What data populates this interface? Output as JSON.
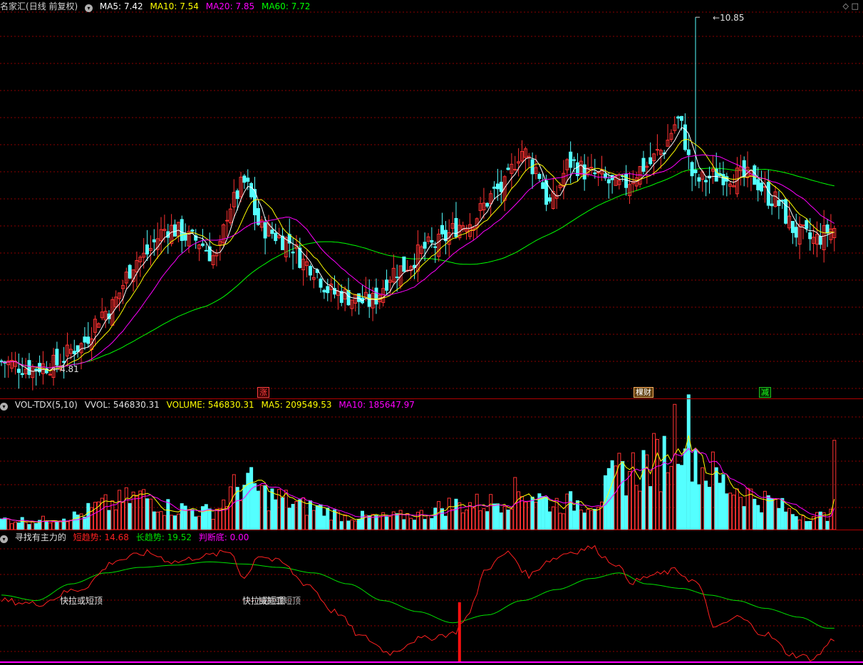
{
  "header": {
    "stock_name": "名家汇",
    "period": "(日线 前复权)",
    "ma5_label": "MA5:",
    "ma5_value": "7.42",
    "ma10_label": "MA10:",
    "ma10_value": "7.54",
    "ma20_label": "MA20:",
    "ma20_value": "7.85",
    "ma60_label": "MA60:",
    "ma60_value": "7.72"
  },
  "volume_header": {
    "indicator": "VOL-TDX(5,10)",
    "vvol_label": "VVOL:",
    "vvol_value": "546830.31",
    "volume_label": "VOLUME:",
    "volume_value": "546830.31",
    "ma5_label": "MA5:",
    "ma5_value": "209549.53",
    "ma10_label": "MA10:",
    "ma10_value": "185647.97"
  },
  "indicator_header": {
    "name": "寻找有主力的",
    "short_label": "短趋势:",
    "short_value": "14.68",
    "long_label": "长趋势:",
    "long_value": "19.52",
    "bottom_label": "判断底:",
    "bottom_value": "0.00"
  },
  "annotations": {
    "high_label": "10.85",
    "low_label": "4.81",
    "tag1": "涨",
    "tag2": "棵财",
    "tag3": "减",
    "signal1": "快拉或短顶",
    "signal2": "快拉或短顶",
    "signal2_overlap": "快拉或短顶"
  },
  "colors": {
    "up": "#ff3232",
    "down": "#54ffff",
    "ma5": "#ffffff",
    "ma10": "#ffff00",
    "ma20": "#ff00ff",
    "ma60": "#00ff00",
    "grid": "#8b0000",
    "short_trend": "#ff2020",
    "long_trend": "#00e000",
    "bottom": "#ff00ff"
  },
  "chart_data": [
    {
      "type": "candlestick",
      "title": "名家汇 (日线 前复权)",
      "ohlc_anchors": [
        [
          0,
          5.05
        ],
        [
          8,
          4.95
        ],
        [
          15,
          5.0
        ],
        [
          22,
          5.3
        ],
        [
          30,
          5.9
        ],
        [
          40,
          6.8
        ],
        [
          48,
          7.3
        ],
        [
          56,
          7.1
        ],
        [
          62,
          6.8
        ],
        [
          66,
          7.7
        ],
        [
          70,
          8.05
        ],
        [
          75,
          7.3
        ],
        [
          82,
          7.1
        ],
        [
          88,
          6.7
        ],
        [
          96,
          6.2
        ],
        [
          106,
          6.05
        ],
        [
          114,
          6.6
        ],
        [
          124,
          7.0
        ],
        [
          134,
          7.4
        ],
        [
          144,
          7.95
        ],
        [
          150,
          8.6
        ],
        [
          154,
          8.3
        ],
        [
          158,
          7.7
        ],
        [
          164,
          8.4
        ],
        [
          170,
          8.2
        ],
        [
          178,
          8.0
        ],
        [
          186,
          8.35
        ],
        [
          190,
          8.6
        ],
        [
          195,
          9.1
        ],
        [
          200,
          8.1
        ],
        [
          208,
          8.2
        ],
        [
          216,
          8.15
        ],
        [
          222,
          7.8
        ],
        [
          230,
          7.2
        ],
        [
          234,
          7.1
        ],
        [
          240,
          7.3
        ]
      ],
      "price_high": 10.85,
      "price_low": 4.81,
      "ma_current": {
        "MA5": 7.42,
        "MA10": 7.54,
        "MA20": 7.85,
        "MA60": 7.72
      }
    },
    {
      "type": "bar",
      "title": "VOL-TDX(5,10)",
      "series": [
        {
          "name": "VOLUME",
          "last": 546830.31
        },
        {
          "name": "MA5",
          "last": 209549.53
        },
        {
          "name": "MA10",
          "last": 185647.97
        }
      ],
      "volume_anchors": [
        [
          0,
          60000
        ],
        [
          10,
          55000
        ],
        [
          20,
          80000
        ],
        [
          30,
          150000
        ],
        [
          40,
          200000
        ],
        [
          50,
          130000
        ],
        [
          60,
          110000
        ],
        [
          70,
          280000
        ],
        [
          78,
          200000
        ],
        [
          88,
          140000
        ],
        [
          100,
          80000
        ],
        [
          110,
          75000
        ],
        [
          120,
          90000
        ],
        [
          130,
          150000
        ],
        [
          140,
          160000
        ],
        [
          150,
          230000
        ],
        [
          160,
          160000
        ],
        [
          170,
          170000
        ],
        [
          180,
          360000
        ],
        [
          190,
          420000
        ],
        [
          196,
          680000
        ],
        [
          202,
          380000
        ],
        [
          210,
          260000
        ],
        [
          220,
          180000
        ],
        [
          230,
          90000
        ],
        [
          238,
          80000
        ],
        [
          240,
          360000
        ]
      ]
    },
    {
      "type": "line",
      "title": "寻找有主力的",
      "series": [
        {
          "name": "短趋势",
          "last": 14.68
        },
        {
          "name": "长趋势",
          "last": 19.52
        },
        {
          "name": "判断底",
          "last": 0.0
        }
      ],
      "short_anchors": [
        [
          0,
          55
        ],
        [
          10,
          52
        ],
        [
          22,
          65
        ],
        [
          34,
          92
        ],
        [
          42,
          98
        ],
        [
          50,
          90
        ],
        [
          58,
          95
        ],
        [
          66,
          99
        ],
        [
          70,
          75
        ],
        [
          74,
          96
        ],
        [
          80,
          90
        ],
        [
          88,
          70
        ],
        [
          96,
          45
        ],
        [
          104,
          22
        ],
        [
          112,
          8
        ],
        [
          120,
          20
        ],
        [
          130,
          25
        ],
        [
          134,
          40
        ],
        [
          140,
          85
        ],
        [
          146,
          98
        ],
        [
          152,
          78
        ],
        [
          158,
          92
        ],
        [
          164,
          99
        ],
        [
          170,
          103
        ],
        [
          176,
          90
        ],
        [
          182,
          72
        ],
        [
          188,
          78
        ],
        [
          194,
          82
        ],
        [
          200,
          72
        ],
        [
          206,
          30
        ],
        [
          212,
          40
        ],
        [
          220,
          25
        ],
        [
          228,
          6
        ],
        [
          234,
          3
        ],
        [
          240,
          20
        ]
      ],
      "long_anchors": [
        [
          0,
          60
        ],
        [
          10,
          55
        ],
        [
          20,
          70
        ],
        [
          30,
          80
        ],
        [
          40,
          85
        ],
        [
          50,
          87
        ],
        [
          60,
          90
        ],
        [
          70,
          88
        ],
        [
          80,
          85
        ],
        [
          90,
          80
        ],
        [
          100,
          70
        ],
        [
          110,
          55
        ],
        [
          120,
          45
        ],
        [
          130,
          35
        ],
        [
          140,
          42
        ],
        [
          150,
          55
        ],
        [
          160,
          65
        ],
        [
          170,
          75
        ],
        [
          178,
          80
        ],
        [
          186,
          70
        ],
        [
          196,
          66
        ],
        [
          204,
          60
        ],
        [
          212,
          55
        ],
        [
          220,
          48
        ],
        [
          230,
          40
        ],
        [
          238,
          30
        ],
        [
          240,
          30
        ]
      ],
      "bottom_signal_index": 132
    }
  ]
}
